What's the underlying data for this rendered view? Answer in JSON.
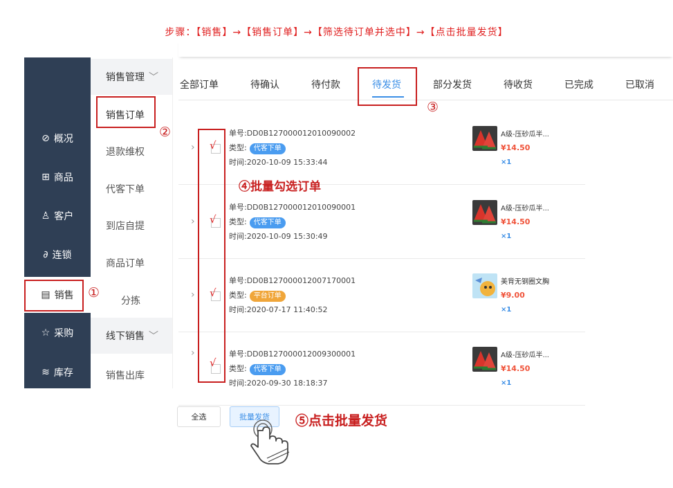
{
  "instruction": "步骤：【销售】→【销售订单】→【筛选待订单并选中】→【点击批量发货】",
  "sidebar": {
    "items": [
      {
        "icon": "compass-icon",
        "glyph": "⊘",
        "label": "概况"
      },
      {
        "icon": "grid-icon",
        "glyph": "⊞",
        "label": "商品"
      },
      {
        "icon": "user-icon",
        "glyph": "♙",
        "label": "客户"
      },
      {
        "icon": "link-icon",
        "glyph": "∂",
        "label": "连锁"
      },
      {
        "icon": "clipboard-icon",
        "glyph": "▤",
        "label": "销售"
      },
      {
        "icon": "star-icon",
        "glyph": "☆",
        "label": "采购"
      },
      {
        "icon": "layers-icon",
        "glyph": "≋",
        "label": "库存"
      }
    ],
    "active": "销售"
  },
  "subnav": {
    "group1": "销售管理",
    "items": [
      "销售订单",
      "退款维权",
      "代客下单",
      "到店自提",
      "商品订单",
      "分拣"
    ],
    "group2": "线下销售",
    "items2": [
      "销售出库"
    ]
  },
  "tabs": [
    "全部订单",
    "待确认",
    "待付款",
    "待发货",
    "部分发货",
    "待收货",
    "已完成",
    "已取消"
  ],
  "active_tab": "待发货",
  "orders": [
    {
      "no": "单号:DD0B127000012010090002",
      "type_label": "类型:",
      "type": "代客下单",
      "time": "时间:2020-10-09 15:33:44",
      "product": "A级-压砂瓜半...",
      "price": "¥14.50",
      "qty": "×1",
      "checked": true
    },
    {
      "no": "单号:DD0B127000012010090001",
      "type_label": "类型:",
      "type": "代客下单",
      "time": "时间:2020-10-09 15:30:49",
      "product": "A级-压砂瓜半...",
      "price": "¥14.50",
      "qty": "×1",
      "checked": true
    },
    {
      "no": "单号:DD0B127000012007170001",
      "type_label": "类型:",
      "type": "平台订单",
      "time": "时间:2020-07-17 11:40:52",
      "product": "美背无钢圈文胸",
      "price": "¥9.00",
      "qty": "×1",
      "checked": true
    },
    {
      "no": "单号:DD0B127000012009300001",
      "type_label": "类型:",
      "type": "代客下单",
      "time": "时间:2020-09-30 18:18:37",
      "product": "A级-压砂瓜半...",
      "price": "¥14.50",
      "qty": "×1",
      "checked": true
    }
  ],
  "buttons": {
    "select_all": "全选",
    "batch_ship": "批量发货"
  },
  "annotations": {
    "n1": "①",
    "n2": "②",
    "n3": "③",
    "n4": "④批量勾选订单",
    "n5": "⑤点击批量发货",
    "tick": "√"
  },
  "colors": {
    "accent": "#3a8ee6",
    "annotation": "#c81e1e",
    "sidebar_bg": "#2f3f55",
    "price": "#f0533a"
  }
}
